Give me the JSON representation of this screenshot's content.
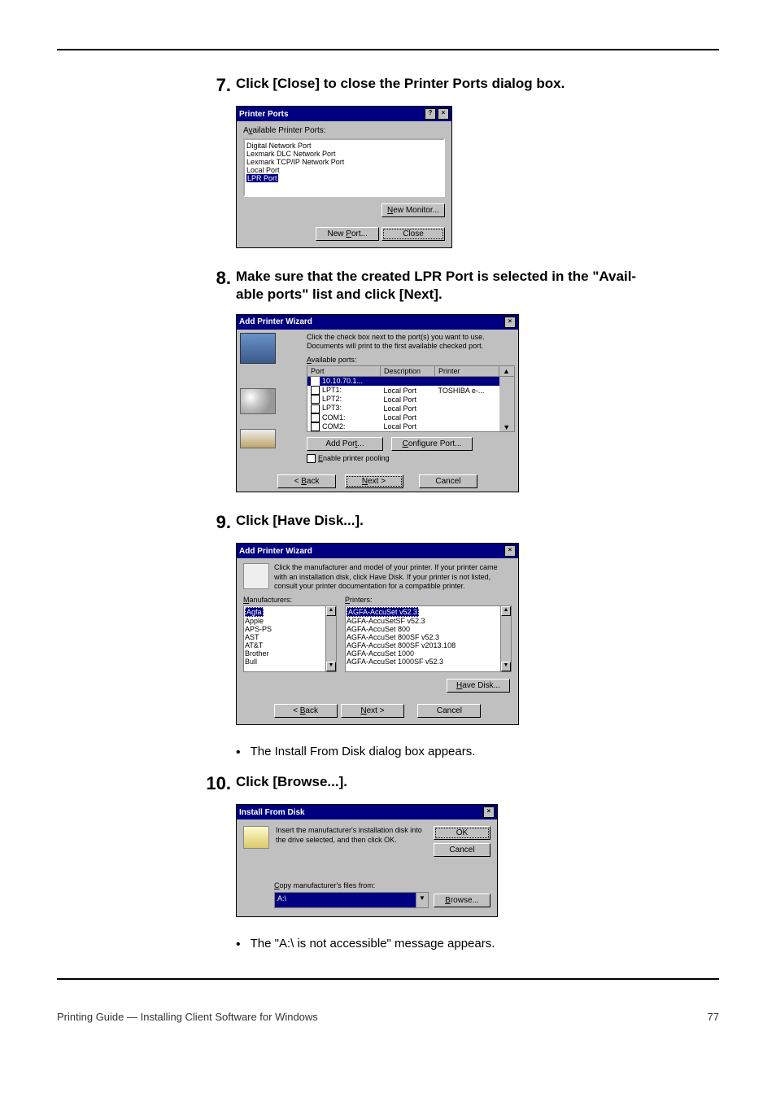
{
  "steps": {
    "s7": {
      "num": "7.",
      "text": "Click [Close] to close the Printer Ports dialog box."
    },
    "s8": {
      "num": "8.",
      "text_line1": "Make sure that the created LPR Port is selected in the \"Avail-",
      "text_line2": "able ports\" list and click [Next]."
    },
    "s9": {
      "num": "9.",
      "text": "Click [Have Disk...]."
    },
    "s10": {
      "num": "10.",
      "text": "Click [Browse...]."
    }
  },
  "bullets": {
    "b1": "The Install From Disk dialog box appears.",
    "b2": "The \"A:\\ is not accessible\" message appears."
  },
  "shot1": {
    "title": "Printer Ports",
    "available_label_pre": "A",
    "available_label_u": "v",
    "available_label_post": "ailable Printer Ports:",
    "items": [
      "Digital Network Port",
      "Lexmark DLC Network Port",
      "Lexmark TCP/IP Network Port",
      "Local Port"
    ],
    "hl_item": "LPR Port",
    "newmon_pre": "",
    "newmon_u": "N",
    "newmon_post": "ew Monitor...",
    "newport_pre": "New ",
    "newport_u": "P",
    "newport_post": "ort...",
    "close_btn": "Close"
  },
  "shot2": {
    "title": "Add Printer Wizard",
    "msg1": "Click the check box next to the port(s) you want to use.",
    "msg2": "Documents will print to the first available checked port.",
    "avail_pre": "",
    "avail_u": "A",
    "avail_post": "vailable ports:",
    "headers": {
      "port": "Port",
      "desc": "Description",
      "printer": "Printer"
    },
    "hl_port": "10.10.70.1...",
    "rows": [
      {
        "port": "LPT1:",
        "desc": "Local Port",
        "printer": "TOSHIBA e-..."
      },
      {
        "port": "LPT2:",
        "desc": "Local Port",
        "printer": ""
      },
      {
        "port": "LPT3:",
        "desc": "Local Port",
        "printer": ""
      },
      {
        "port": "COM1:",
        "desc": "Local Port",
        "printer": ""
      },
      {
        "port": "COM2:",
        "desc": "Local Port",
        "printer": ""
      }
    ],
    "addport_pre": "Add Por",
    "addport_u": "t",
    "addport_post": "...",
    "cfgport_pre": "",
    "cfgport_u": "C",
    "cfgport_post": "onfigure Port...",
    "enable_pre": "",
    "enable_u": "E",
    "enable_post": "nable printer pooling",
    "back_pre": "< ",
    "back_u": "B",
    "back_post": "ack",
    "next_pre": "",
    "next_u": "N",
    "next_post": "ext >",
    "cancel": "Cancel"
  },
  "shot3": {
    "title": "Add Printer Wizard",
    "msg": "Click the manufacturer and model of your printer. If your printer came with an installation disk, click Have Disk. If your printer is not listed, consult your printer documentation for a compatible printer.",
    "manuf_pre": "",
    "manuf_u": "M",
    "manuf_post": "anufacturers:",
    "printers_pre": "",
    "printers_u": "P",
    "printers_post": "rinters:",
    "manuf_hl": "Agfa",
    "manufacturers": [
      "Apple",
      "APS-PS",
      "AST",
      "AT&T",
      "Brother",
      "Bull"
    ],
    "printer_hl": "AGFA-AccuSet v52.3",
    "printers": [
      "AGFA-AccuSetSF v52.3",
      "AGFA-AccuSet 800",
      "AGFA-AccuSet 800SF v52.3",
      "AGFA-AccuSet 800SF v2013.108",
      "AGFA-AccuSet 1000",
      "AGFA-AccuSet 1000SF v52.3"
    ],
    "havedisk_pre": "",
    "havedisk_u": "H",
    "havedisk_post": "ave Disk...",
    "back_pre": "< ",
    "back_u": "B",
    "back_post": "ack",
    "next_pre": "",
    "next_u": "N",
    "next_post": "ext >",
    "cancel": "Cancel"
  },
  "shot4": {
    "title": "Install From Disk",
    "msg": "Insert the manufacturer's installation disk into the drive selected, and then click OK.",
    "ok": "OK",
    "cancel": "Cancel",
    "copy_pre": "",
    "copy_u": "C",
    "copy_post": "opy manufacturer's files from:",
    "combo_val": "A:\\",
    "browse_pre": "",
    "browse_u": "B",
    "browse_post": "rowse..."
  },
  "footer": {
    "left": "Printing Guide — Installing Client Software for Windows",
    "right": "77"
  }
}
